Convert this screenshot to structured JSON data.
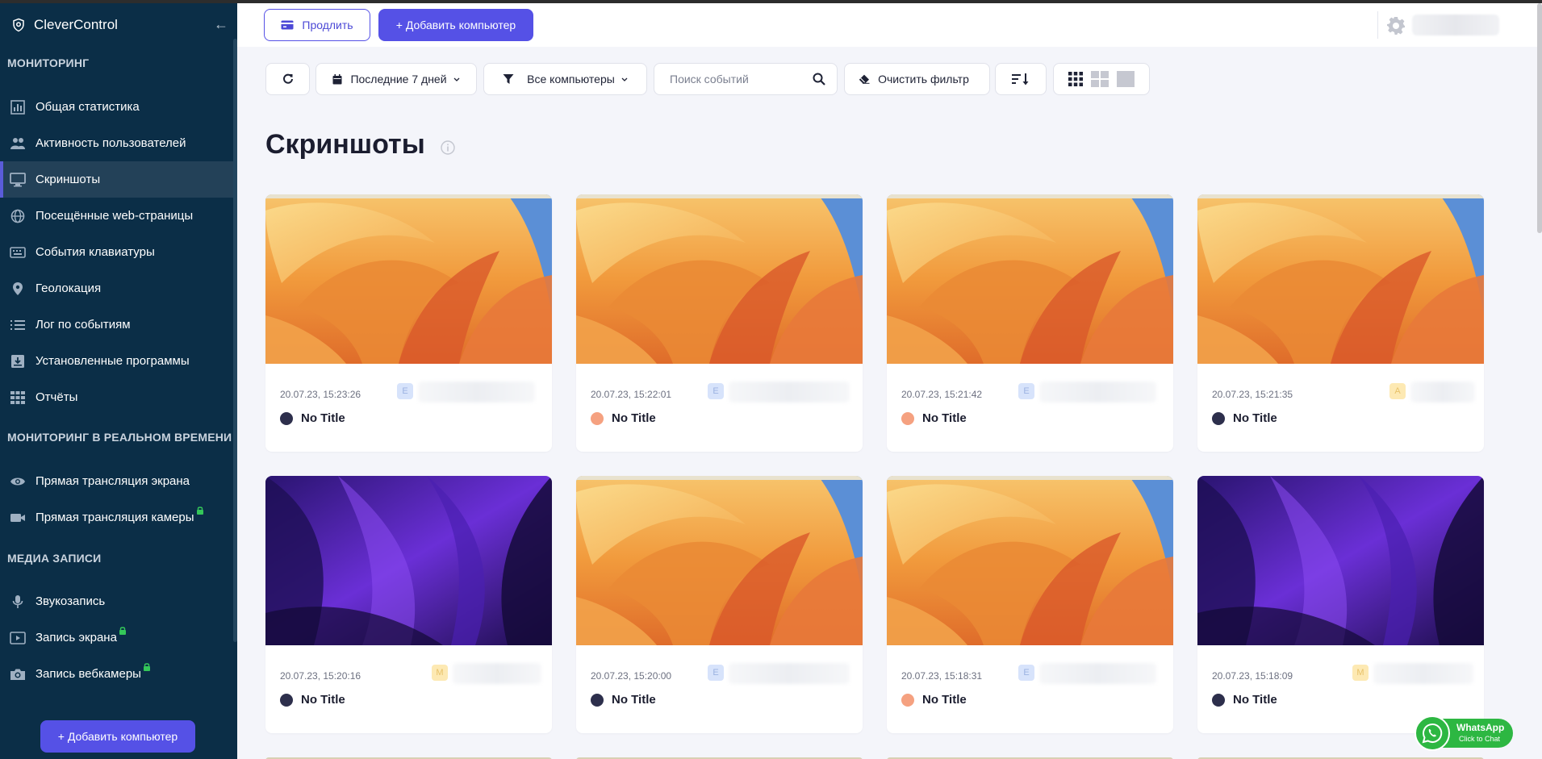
{
  "app": {
    "name": "CleverControl",
    "brand_icon": "shield-icon",
    "accent_color": "#5551e6",
    "sidebar_bg": "#0b2e47"
  },
  "sidebar": {
    "sections": [
      {
        "title": "МОНИТОРИНГ",
        "items": [
          {
            "label": "Общая статистика",
            "icon": "bar-chart-icon"
          },
          {
            "label": "Активность пользователей",
            "icon": "users-icon"
          },
          {
            "label": "Скриншоты",
            "icon": "monitor-icon",
            "active": true
          },
          {
            "label": "Посещённые web-страницы",
            "icon": "globe-icon"
          },
          {
            "label": "События клавиатуры",
            "icon": "keyboard-icon"
          },
          {
            "label": "Геолокация",
            "icon": "map-pin-icon"
          },
          {
            "label": "Лог по событиям",
            "icon": "list-icon"
          },
          {
            "label": "Установленные программы",
            "icon": "download-box-icon"
          },
          {
            "label": "Отчёты",
            "icon": "grid-icon"
          }
        ]
      },
      {
        "title": "МОНИТОРИНГ В РЕАЛЬНОМ ВРЕМЕНИ",
        "items": [
          {
            "label": "Прямая трансляция экрана",
            "icon": "eye-icon"
          },
          {
            "label": "Прямая трансляция камеры",
            "icon": "video-camera-icon",
            "locked": true
          }
        ]
      },
      {
        "title": "МЕДИА ЗАПИСИ",
        "items": [
          {
            "label": "Звукозапись",
            "icon": "microphone-icon"
          },
          {
            "label": "Запись экрана",
            "icon": "play-screen-icon",
            "locked": true
          },
          {
            "label": "Запись вебкамеры",
            "icon": "camera-icon",
            "locked": true
          }
        ]
      }
    ],
    "add_button": "+ Добавить компьютер"
  },
  "header": {
    "renew_button": "Продлить",
    "add_computer_button": "+ Добавить компьютер"
  },
  "toolbar": {
    "refresh_icon": "refresh-icon",
    "date_filter": "Последние 7 дней",
    "computer_filter": "Все компьютеры",
    "search_placeholder": "Поиск событий",
    "clear_filter": "Очистить фильтр",
    "sort_icon": "sort-icon",
    "view_modes": [
      "grid-small-icon",
      "grid-medium-icon",
      "grid-large-icon"
    ]
  },
  "page": {
    "title": "Скриншоты"
  },
  "screenshots": [
    {
      "date": "20.07.23, 15:23:26",
      "user_badge": "E",
      "badge_color": "blue",
      "title": "No Title",
      "status_color": "dark",
      "wallpaper": "orange"
    },
    {
      "date": "20.07.23, 15:22:01",
      "user_badge": "E",
      "badge_color": "blue",
      "title": "No Title",
      "status_color": "salmon",
      "wallpaper": "orange"
    },
    {
      "date": "20.07.23, 15:21:42",
      "user_badge": "E",
      "badge_color": "blue",
      "title": "No Title",
      "status_color": "salmon",
      "wallpaper": "orange"
    },
    {
      "date": "20.07.23, 15:21:35",
      "user_badge": "A",
      "badge_color": "yellow",
      "title": "No Title",
      "status_color": "dark",
      "wallpaper": "orange"
    },
    {
      "date": "20.07.23, 15:20:16",
      "user_badge": "M",
      "badge_color": "yellow",
      "title": "No Title",
      "status_color": "dark",
      "wallpaper": "purple"
    },
    {
      "date": "20.07.23, 15:20:00",
      "user_badge": "E",
      "badge_color": "blue",
      "title": "No Title",
      "status_color": "dark",
      "wallpaper": "orange"
    },
    {
      "date": "20.07.23, 15:18:31",
      "user_badge": "E",
      "badge_color": "blue",
      "title": "No Title",
      "status_color": "salmon",
      "wallpaper": "orange"
    },
    {
      "date": "20.07.23, 15:18:09",
      "user_badge": "M",
      "badge_color": "yellow",
      "title": "No Title",
      "status_color": "dark",
      "wallpaper": "purple"
    }
  ],
  "whatsapp": {
    "title": "WhatsApp",
    "subtitle": "Click to Chat"
  }
}
